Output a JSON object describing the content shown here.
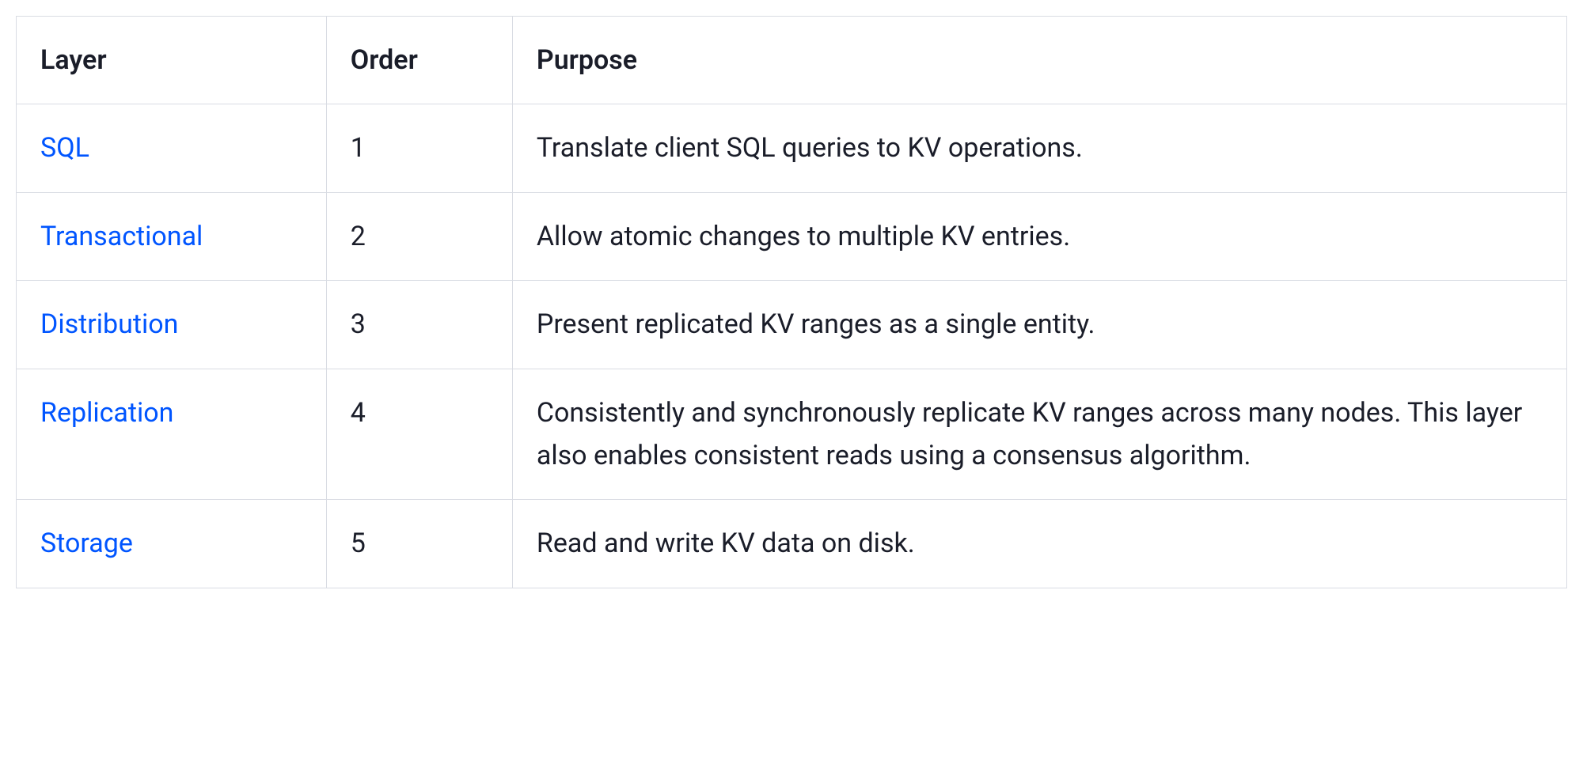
{
  "table": {
    "headers": {
      "layer": "Layer",
      "order": "Order",
      "purpose": "Purpose"
    },
    "rows": [
      {
        "layer": "SQL",
        "order": "1",
        "purpose": "Translate client SQL queries to KV operations."
      },
      {
        "layer": "Transactional",
        "order": "2",
        "purpose": "Allow atomic changes to multiple KV entries."
      },
      {
        "layer": "Distribution",
        "order": "3",
        "purpose": "Present replicated KV ranges as a single entity."
      },
      {
        "layer": "Replication",
        "order": "4",
        "purpose": "Consistently and synchronously replicate KV ranges across many nodes. This layer also enables consistent reads using a consensus algorithm."
      },
      {
        "layer": "Storage",
        "order": "5",
        "purpose": "Read and write KV data on disk."
      }
    ]
  }
}
